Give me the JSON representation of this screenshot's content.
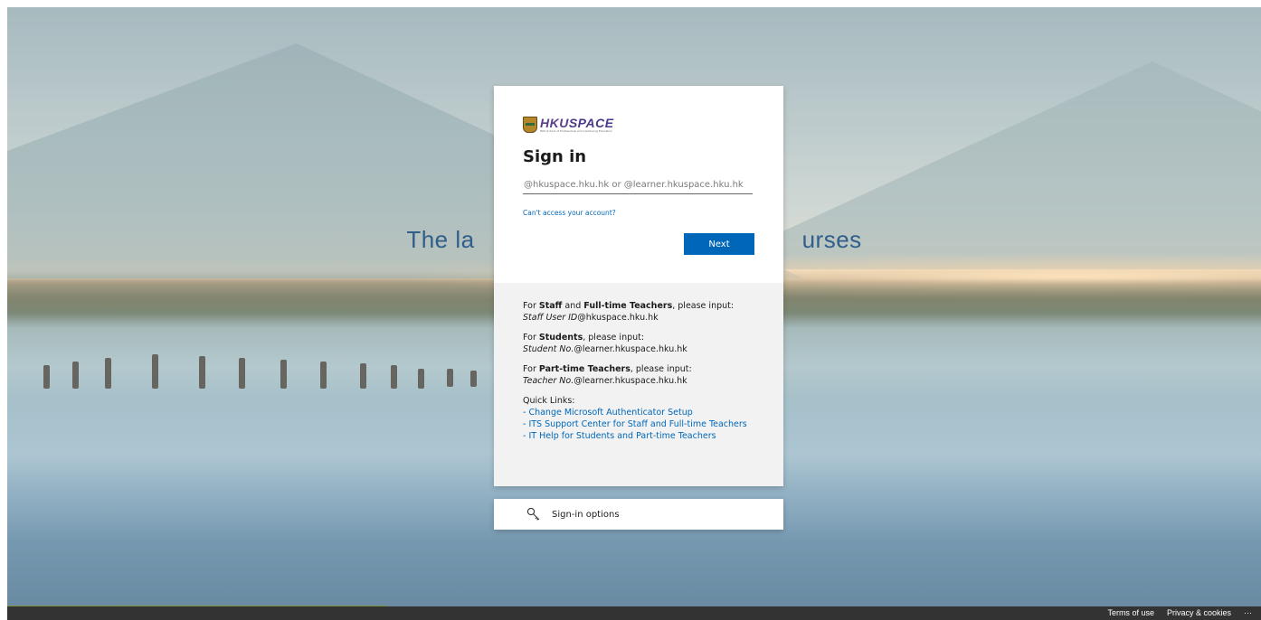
{
  "background": {
    "tagline_left": "The la",
    "tagline_right": "urses"
  },
  "brand": {
    "logo_main": "HKU",
    "logo_space": "SPACE",
    "logo_subtitle": "HKU School of Professional and Continuing Education"
  },
  "signin": {
    "title": "Sign in",
    "placeholder": "@hkuspace.hku.hk or @learner.hkuspace.hku.hk",
    "value": "",
    "cant_access": "Can't access your account?",
    "next_label": "Next"
  },
  "info": {
    "staff": {
      "prefix": "For ",
      "bold1": "Staff",
      "mid": " and ",
      "bold2": "Full-time Teachers",
      "suffix": ", please input:",
      "id_italic": "Staff User ID",
      "domain": "@hkuspace.hku.hk"
    },
    "students": {
      "prefix": "For ",
      "bold": "Students",
      "suffix": ", please input:",
      "id_italic": "Student No.",
      "domain": "@learner.hkuspace.hku.hk"
    },
    "parttime": {
      "prefix": "For ",
      "bold": "Part-time Teachers",
      "suffix": ", please input:",
      "id_italic": "Teacher No.",
      "domain": "@learner.hkuspace.hku.hk"
    },
    "quick_links_title": "Quick Links:",
    "quick_links": [
      "- Change Microsoft Authenticator Setup",
      "- ITS Support Center for Staff and Full-time Teachers",
      "- IT Help for Students and Part-time Teachers"
    ]
  },
  "options": {
    "label": "Sign-in options"
  },
  "footer": {
    "terms": "Terms of use",
    "privacy": "Privacy & cookies",
    "more": "···"
  },
  "colors": {
    "accent": "#0067b8",
    "footer_bg": "#333333",
    "info_bg": "#f2f2f2"
  },
  "icons": [
    "key-icon",
    "hku-shield-logo"
  ]
}
